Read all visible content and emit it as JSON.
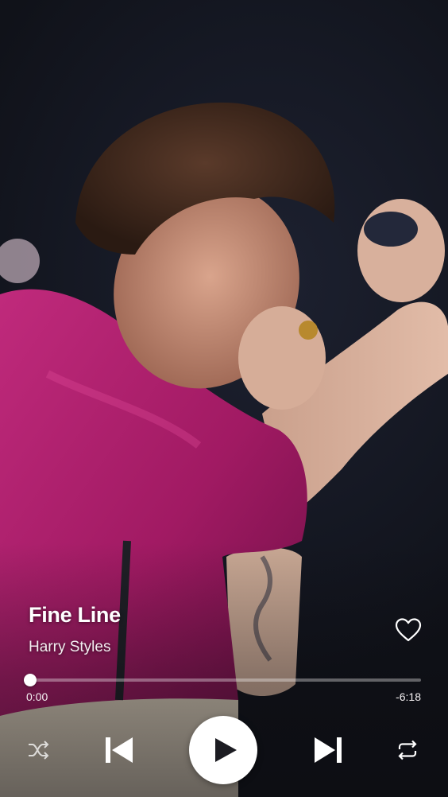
{
  "track": {
    "title": "Fine Line",
    "artist": "Harry Styles",
    "liked": false
  },
  "progress": {
    "elapsed": "0:00",
    "remaining": "-6:18",
    "fraction": 0.0
  },
  "controls": {
    "shuffle_icon": "shuffle-icon",
    "previous_icon": "skip-previous-icon",
    "play_icon": "play-icon",
    "next_icon": "skip-next-icon",
    "repeat_icon": "repeat-icon",
    "like_icon": "heart-outline-icon"
  },
  "colors": {
    "accent": "#ffffff",
    "shirt": "#b0206e",
    "background": "#14161f"
  }
}
